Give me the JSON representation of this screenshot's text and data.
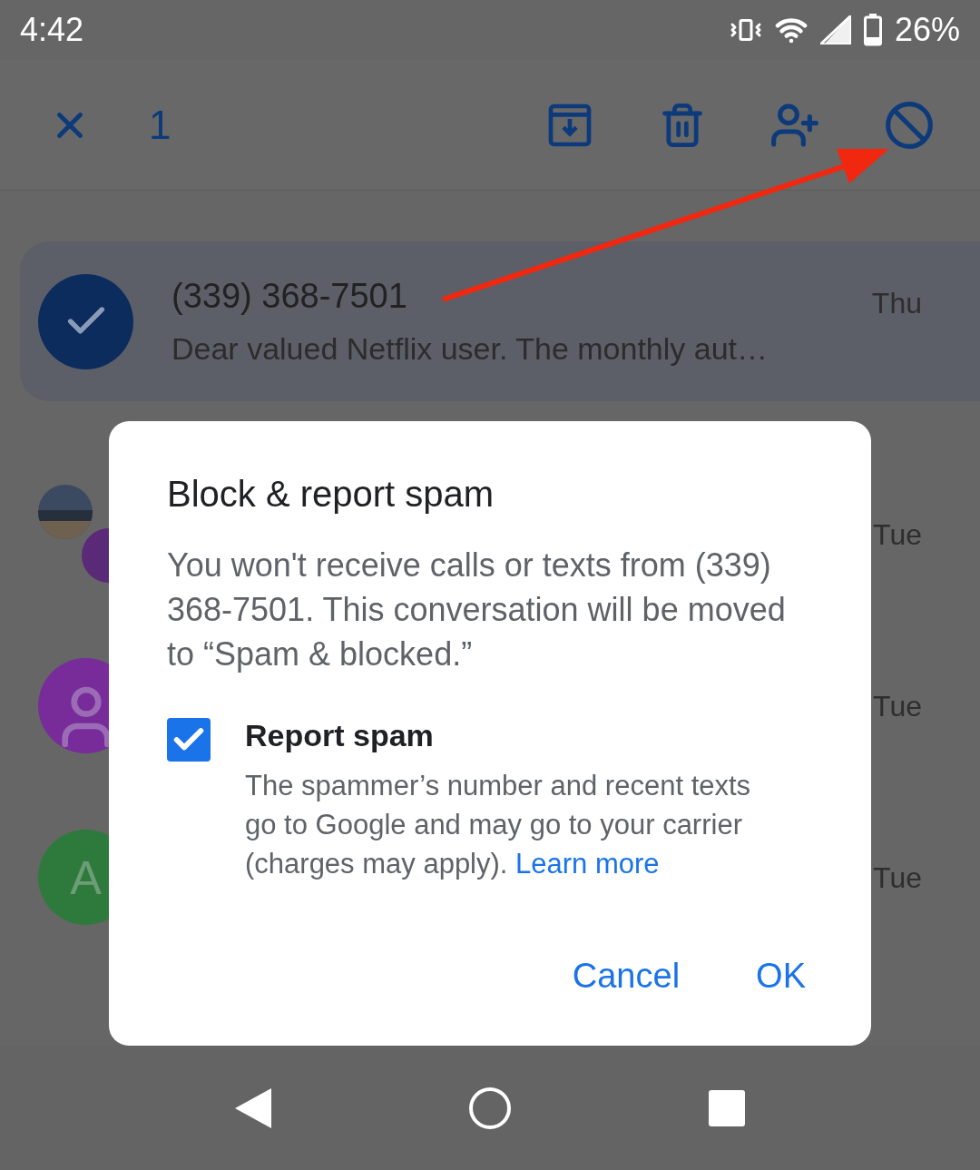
{
  "status_bar": {
    "time": "4:42",
    "battery": "26%"
  },
  "toolbar": {
    "selected_count": "1"
  },
  "conversations": [
    {
      "selected": true,
      "name": "(339) 368-7501",
      "snippet": "Dear valued Netflix user. The monthly aut…",
      "time": "Thu"
    },
    {
      "selected": false,
      "time": "Tue"
    },
    {
      "selected": false,
      "avatar": {
        "kind": "person",
        "color": "#772c9a"
      },
      "time": "Tue"
    },
    {
      "selected": false,
      "avatar": {
        "kind": "letter",
        "letter": "A",
        "color": "#2e7a3c"
      },
      "time": "Tue"
    }
  ],
  "dialog": {
    "title": "Block & report spam",
    "message": "You won't receive calls or texts from (339) 368-7501. This conversation will be moved to “Spam & blocked.”",
    "option": {
      "label": "Report spam",
      "checked": true,
      "description": "The spammer’s number and recent texts go to Google and may go to your carrier (charges may apply).",
      "link": "Learn more"
    },
    "buttons": [
      "Cancel",
      "OK"
    ]
  }
}
